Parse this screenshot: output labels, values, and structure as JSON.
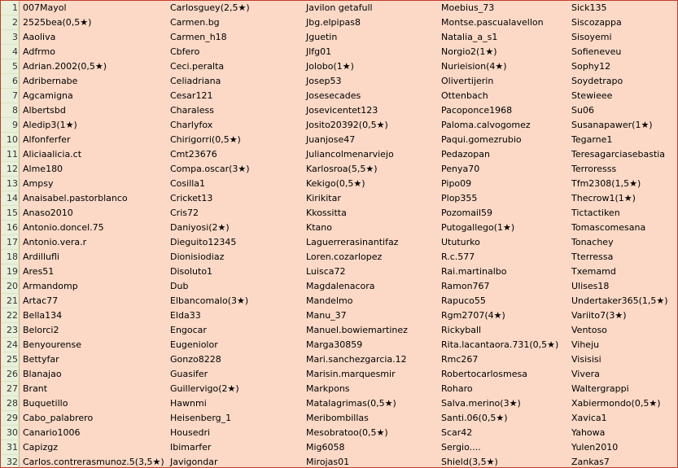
{
  "sheet": {
    "rows": [
      {
        "n": "1",
        "cells": [
          "007Mayol",
          "Carlosguey(2,5★)",
          "Javilon getafull",
          "Moebius_73",
          "Sick135"
        ]
      },
      {
        "n": "2",
        "cells": [
          "2525bea(0,5★)",
          "Carmen.bg",
          "Jbg.elpipas8",
          "Montse.pascualavellon",
          "Siscozappa"
        ]
      },
      {
        "n": "3",
        "cells": [
          "Aaoliva",
          "Carmen_h18",
          "Jguetin",
          "Natalia_a_s1",
          "Sisoyemi"
        ]
      },
      {
        "n": "4",
        "cells": [
          "Adfrmo",
          "Cbfero",
          "Jlfg01",
          "Norgio2(1★)",
          "Sofieneveu"
        ]
      },
      {
        "n": "5",
        "cells": [
          "Adrian.2002(0,5★)",
          "Ceci.peralta",
          "Jolobo(1★)",
          "Nurieision(4★)",
          "Sophy12"
        ]
      },
      {
        "n": "6",
        "cells": [
          "Adribernabe",
          "Celiadriana",
          "Josep53",
          "Olivertijerin",
          "Soydetrapo"
        ]
      },
      {
        "n": "7",
        "cells": [
          "Agcamigna",
          "Cesar121",
          "Josesecades",
          "Ottenbach",
          "Stewieee"
        ]
      },
      {
        "n": "8",
        "cells": [
          "Albertsbd",
          "Charaless",
          "Josevicentet123",
          "Pacoponce1968",
          "Su06"
        ]
      },
      {
        "n": "9",
        "cells": [
          "Aledip3(1★)",
          "Charlyfox",
          "Josito20392(0,5★)",
          "Paloma.calvogomez",
          "Susanapawer(1★)"
        ]
      },
      {
        "n": "10",
        "cells": [
          "Alfonferfer",
          "Chirigorri(0,5★)",
          "Juanjose47",
          "Paqui.gomezrubio",
          "Tegarne1"
        ]
      },
      {
        "n": "11",
        "cells": [
          "Aliciaalicia.ct",
          "Cmt23676",
          "Juliancolmenarviejo",
          "Pedazopan",
          "Teresagarciasebastia"
        ]
      },
      {
        "n": "12",
        "cells": [
          "Alme180",
          "Compa.oscar(3★)",
          "Karlosroa(5,5★)",
          "Penya70",
          "Terroresss"
        ]
      },
      {
        "n": "13",
        "cells": [
          "Ampsy",
          "Cosilla1",
          "Kekigo(0,5★)",
          "Pipo09",
          "Tfm2308(1,5★)"
        ]
      },
      {
        "n": "14",
        "cells": [
          "Anaisabel.pastorblanco",
          "Cricket13",
          "Kirikitar",
          "Plop355",
          "Thecrow1(1★)"
        ]
      },
      {
        "n": "15",
        "cells": [
          "Anaso2010",
          "Cris72",
          "Kkossitta",
          "Pozomail59",
          "Tictactiken"
        ]
      },
      {
        "n": "16",
        "cells": [
          "Antonio.doncel.75",
          "Daniyosi(2★)",
          "Ktano",
          "Putogallego(1★)",
          "Tomascomesana"
        ]
      },
      {
        "n": "17",
        "cells": [
          "Antonio.vera.r",
          "Dieguito12345",
          "Laguerrerasinantifaz",
          "Ututurko",
          "Tonachey"
        ]
      },
      {
        "n": "18",
        "cells": [
          "Ardillufli",
          "Dionisiodiaz",
          "Loren.cozarlopez",
          "R.c.577",
          "Tterressa"
        ]
      },
      {
        "n": "19",
        "cells": [
          "Ares51",
          "Disoluto1",
          "Luisca72",
          "Rai.martinalbo",
          "Txemamd"
        ]
      },
      {
        "n": "20",
        "cells": [
          "Armandomp",
          "Dub",
          "Magdalenacora",
          "Ramon767",
          "Ulises18"
        ]
      },
      {
        "n": "21",
        "cells": [
          "Artac77",
          "Elbancomalo(3★)",
          "Mandelmo",
          "Rapuco55",
          "Undertaker365(1,5★)"
        ]
      },
      {
        "n": "22",
        "cells": [
          "Bella134",
          "Elda33",
          "Manu_37",
          "Rgm2707(4★)",
          "Variito7(3★)"
        ]
      },
      {
        "n": "23",
        "cells": [
          "Belorci2",
          "Engocar",
          "Manuel.bowiemartinez",
          "Rickyball",
          "Ventoso"
        ]
      },
      {
        "n": "24",
        "cells": [
          "Benyourense",
          "Eugeniolor",
          "Marga30859",
          "Rita.lacantaora.731(0,5★)",
          "Viheju"
        ]
      },
      {
        "n": "25",
        "cells": [
          "Bettyfar",
          "Gonzo8228",
          "Mari.sanchezgarcia.12",
          "Rmc267",
          "Visisisi"
        ]
      },
      {
        "n": "26",
        "cells": [
          "Blanajao",
          "Guasifer",
          "Marisin.marquesmir",
          "Robertocarlosmesa",
          "Vivera"
        ]
      },
      {
        "n": "27",
        "cells": [
          "Brant",
          "Guillervigo(2★)",
          "Markpons",
          "Roharo",
          "Waltergrappi"
        ]
      },
      {
        "n": "28",
        "cells": [
          "Buquetillo",
          "Hawnmi",
          "Matalagrimas(0,5★)",
          "Salva.merino(3★)",
          "Xabiermondo(0,5★)"
        ]
      },
      {
        "n": "29",
        "cells": [
          "Cabo_palabrero",
          "Heisenberg_1",
          "Meribombillas",
          "Santi.06(0,5★)",
          "Xavica1"
        ]
      },
      {
        "n": "30",
        "cells": [
          "Canario1006",
          "Housedri",
          "Mesobratoo(0,5★)",
          "Scar42",
          "Yahowa"
        ]
      },
      {
        "n": "31",
        "cells": [
          "Capizgz",
          "Ibimarfer",
          "Mig6058",
          "Sergio....",
          "Yulen2010"
        ]
      },
      {
        "n": "32",
        "cells": [
          "Carlos.contrerasmunoz.5(3,5★)",
          "Javigondar",
          "Mirojas01",
          "Shield(3,5★)",
          "Zankas7"
        ]
      }
    ]
  }
}
